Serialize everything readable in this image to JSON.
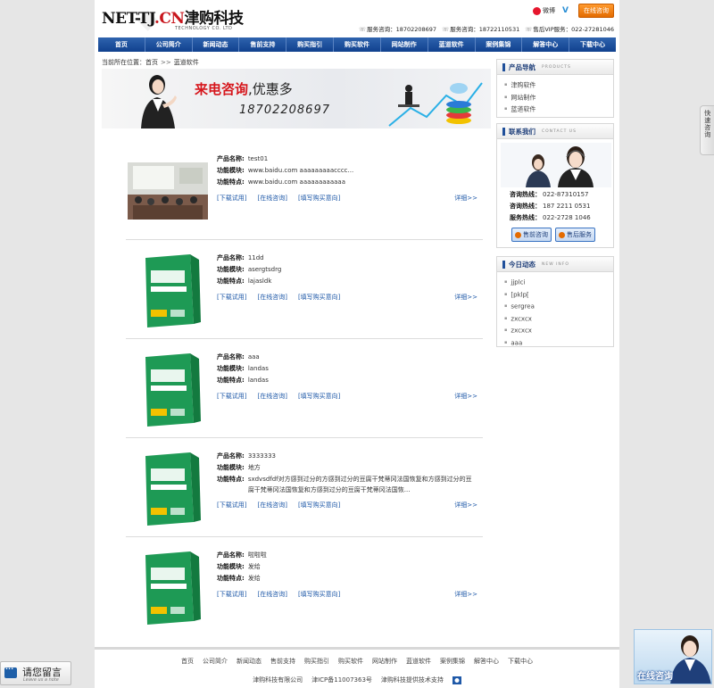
{
  "logo": {
    "main_prefix": "NET-TJ",
    "main_dot": ".CN",
    "main_cn": "津购科技",
    "sub": "TECHNOLOGY CO. LTD"
  },
  "top": {
    "weibo_label": "微博",
    "online_btn": "在线咨询"
  },
  "phones": [
    {
      "label": "服务咨询：",
      "value": "18702208697"
    },
    {
      "label": "服务咨询：",
      "value": "18722110531"
    },
    {
      "label": "售后VIP服务：",
      "value": "022-27281046"
    }
  ],
  "nav": [
    "首页",
    "公司简介",
    "新闻动态",
    "售前支持",
    "购买指引",
    "购买软件",
    "网站制作",
    "蓝道软件",
    "案例集锦",
    "解答中心",
    "下载中心"
  ],
  "breadcrumb": {
    "label": "当前所在位置：",
    "home": "首页",
    "sep": ">>",
    "current": "蓝道软件"
  },
  "banner": {
    "title_red": "来电咨询",
    "title_rest": ",优惠多",
    "phone": "18702208697"
  },
  "labels": {
    "name": "产品名称:",
    "module": "功能模块:",
    "feature": "功能特点:"
  },
  "actions": {
    "download": "[下载试用]",
    "consult": "[在线咨询]",
    "intent": "[填写购买意向]",
    "more": "详细>>"
  },
  "products": [
    {
      "name": "test01",
      "module": "www.baidu.com aaaaaaaaacccc...",
      "feature": "www.baidu.com aaaaaaaaaaaa",
      "thumb": "classroom-photo"
    },
    {
      "name": "11dd",
      "module": "asergtsdrg",
      "feature": "lajasldk",
      "thumb": "software-box"
    },
    {
      "name": "aaa",
      "module": "landas",
      "feature": "landas",
      "thumb": "software-box"
    },
    {
      "name": "3333333",
      "module": "地方",
      "feature": "sxdvsdfdf对方感到过分的方感到过分的豆腐干梵蒂冈法国恢复和方感到过分的豆腐干梵蒂冈法国恢复和方感到过分的豆腐干梵蒂冈法国恢...",
      "thumb": "software-box"
    },
    {
      "name": "啦啦啦",
      "module": "发给",
      "feature": "发给",
      "thumb": "software-box"
    }
  ],
  "sidebar": {
    "products": {
      "title": "产品导航",
      "en": "PRODUCTS",
      "items": [
        "津购软件",
        "网站制作",
        "蓝道软件"
      ]
    },
    "contact": {
      "title": "联系我们",
      "en": "CONTACT US",
      "rows": [
        {
          "label": "咨询热线：",
          "value": "022-87310157"
        },
        {
          "label": "咨询热线：",
          "value": "187 2211 0531"
        },
        {
          "label": "服务热线：",
          "value": "022-2728 1046"
        }
      ],
      "btn_pre": "售前咨询",
      "btn_post": "售后服务"
    },
    "news": {
      "title": "今日动态",
      "en": "NEW INFO",
      "items": [
        "jjplci",
        "[pklp[",
        "sergrea",
        "zxcxcx",
        "zxcxcx",
        "aaa"
      ]
    }
  },
  "footer": {
    "links": [
      "首页",
      "公司简介",
      "新闻动态",
      "售前支持",
      "购买指引",
      "购买软件",
      "网站制作",
      "蓝道软件",
      "案例集锦",
      "解答中心",
      "下载中心"
    ],
    "company": "津购科技有限公司",
    "icp": "津ICP备11007363号",
    "support": "津购科技提供技术支持"
  },
  "float": {
    "side_tab": "快速咨询",
    "msg_cn": "请您留言",
    "msg_en": "Leave us a note",
    "online": "在线咨询"
  },
  "colors": {
    "nav": "#1a4c98",
    "accent_red": "#d6161c",
    "link": "#1f59a8"
  }
}
